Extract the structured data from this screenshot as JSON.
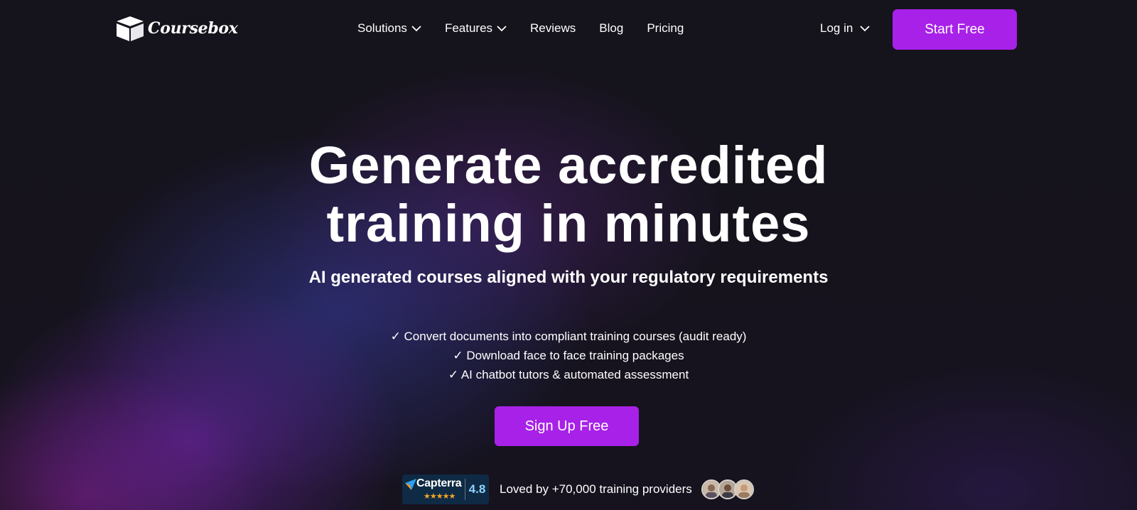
{
  "nav": {
    "logo_text": "Coursebox",
    "items": [
      {
        "label": "Solutions",
        "has_dropdown": true
      },
      {
        "label": "Features",
        "has_dropdown": true
      },
      {
        "label": "Reviews",
        "has_dropdown": false
      },
      {
        "label": "Blog",
        "has_dropdown": false
      },
      {
        "label": "Pricing",
        "has_dropdown": false
      }
    ],
    "login_label": "Log in",
    "start_label": "Start Free"
  },
  "hero": {
    "title_line1": "Generate accredited",
    "title_line2": "training in minutes",
    "subtitle": "AI generated courses aligned with your regulatory requirements",
    "features": [
      "✓ Convert documents into compliant training courses (audit ready)",
      "✓ Download face to face training packages",
      "✓ AI chatbot tutors & automated assessment"
    ],
    "cta_label": "Sign Up Free"
  },
  "rating": {
    "badge_name": "Capterra",
    "badge_score": "4.8",
    "stars": 5,
    "loved_text": "Loved by +70,000 training providers"
  },
  "colors": {
    "accent": "#a821e8",
    "background": "#14121c",
    "capterra_bg": "#0f2a44",
    "star": "#f5a623"
  },
  "icons": [
    "coursebox-box-logo-icon",
    "chevron-down-icon",
    "capterra-arrow-icon",
    "star-icon",
    "avatar"
  ]
}
